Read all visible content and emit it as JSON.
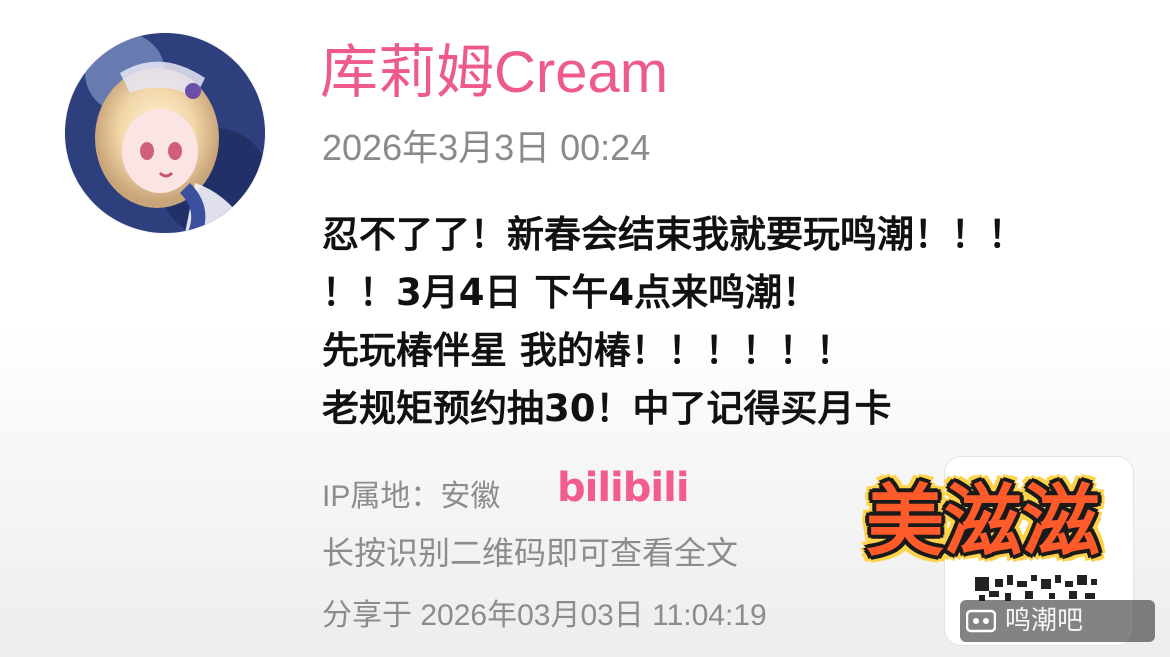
{
  "post": {
    "username": "库莉姆Cream",
    "timestamp": "2026年3月3日 00:24",
    "content_lines": [
      "忍不了了！新春会结束我就要玩鸣潮！！！",
      "！！3月4日 下午4点来鸣潮！",
      "先玩椿伴星 我的椿！！！！！！",
      "老规矩预约抽30！中了记得买月卡"
    ],
    "ip_location": "IP属地：安徽",
    "platform_logo_text": "bilibili",
    "qr_hint": "长按识别二维码即可查看全文",
    "share_time": "分享于 2026年03月03日 11:04:19"
  },
  "overlay": {
    "badge_text": "美滋滋",
    "watermark_text": "鸣潮吧"
  },
  "icons": {
    "avatar": "anime-avatar",
    "qr": "qr-code-icon",
    "watermark": "tieba-paw-icon"
  },
  "colors": {
    "username": "#ee5a8e",
    "bilibili": "#f25d8e",
    "meta_text": "#8c8c8c",
    "content_text": "#111111",
    "badge_fill": "#ff5a2a",
    "badge_outline": "#ffd24a"
  }
}
